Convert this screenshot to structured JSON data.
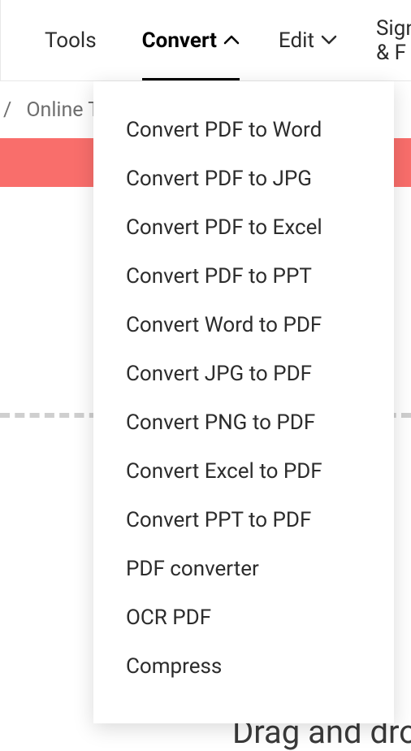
{
  "nav": {
    "tools": "Tools",
    "convert": "Convert",
    "edit": "Edit",
    "sign": "Sign & F"
  },
  "breadcrumb": {
    "text": "Online To"
  },
  "dropdown": {
    "items": [
      "Convert PDF to Word",
      "Convert PDF to JPG",
      "Convert PDF to Excel",
      "Convert PDF to PPT",
      "Convert Word to PDF",
      "Convert JPG to PDF",
      "Convert PNG to PDF",
      "Convert Excel to PDF",
      "Convert PPT to PDF",
      "PDF converter",
      "OCR PDF",
      "Compress"
    ]
  },
  "dragText": "Drag and dro"
}
